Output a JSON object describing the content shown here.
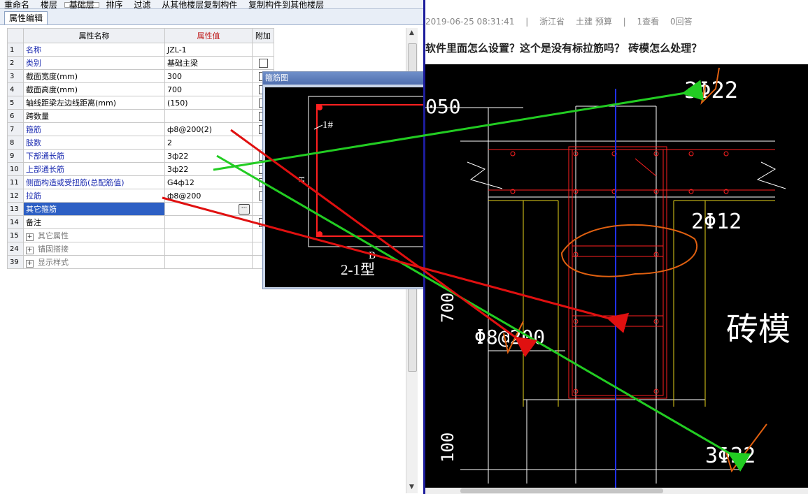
{
  "toolbar": {
    "items": [
      "重命名",
      "楼层",
      "基础层",
      "排序",
      "过滤",
      "从其他楼层复制构件",
      "复制构件到其他楼层"
    ]
  },
  "tab": {
    "label": "属性编辑"
  },
  "grid": {
    "headers": {
      "name": "属性名称",
      "value": "属性值",
      "extra": "附加"
    },
    "rows": [
      {
        "idx": "1",
        "name": "名称",
        "value": "JZL-1",
        "blue": true,
        "check": false
      },
      {
        "idx": "2",
        "name": "类别",
        "value": "基础主梁",
        "blue": true,
        "check": true
      },
      {
        "idx": "3",
        "name": "截面宽度(mm)",
        "value": "300",
        "blue": false,
        "check": true
      },
      {
        "idx": "4",
        "name": "截面高度(mm)",
        "value": "700",
        "blue": false,
        "check": true
      },
      {
        "idx": "5",
        "name": "轴线距梁左边线距离(mm)",
        "value": "(150)",
        "blue": false,
        "check": true
      },
      {
        "idx": "6",
        "name": "跨数量",
        "value": "",
        "blue": false,
        "check": true
      },
      {
        "idx": "7",
        "name": "箍筋",
        "value": "ф8@200(2)",
        "blue": true,
        "check": true
      },
      {
        "idx": "8",
        "name": "肢数",
        "value": "2",
        "blue": true,
        "check": false
      },
      {
        "idx": "9",
        "name": "下部通长筋",
        "value": "3ф22",
        "blue": true,
        "check": true
      },
      {
        "idx": "10",
        "name": "上部通长筋",
        "value": "3ф22",
        "blue": true,
        "check": true
      },
      {
        "idx": "11",
        "name": "侧面构造或受扭筋(总配筋值)",
        "value": "G4ф12",
        "blue": true,
        "check": true
      },
      {
        "idx": "12",
        "name": "拉筋",
        "value": "ф8@200",
        "blue": true,
        "check": true
      },
      {
        "idx": "13",
        "name": "其它箍筋",
        "value": "",
        "blue": false,
        "check": false,
        "selected": true
      },
      {
        "idx": "14",
        "name": "备注",
        "value": "",
        "blue": false,
        "check": true
      },
      {
        "idx": "15",
        "name": "其它属性",
        "value": "",
        "group": true
      },
      {
        "idx": "24",
        "name": "锚固搭接",
        "value": "",
        "group": true
      },
      {
        "idx": "39",
        "name": "显示样式",
        "value": "",
        "group": true
      }
    ]
  },
  "popup": {
    "title": "箍筋图",
    "label_1": "1#",
    "label_h": "H",
    "label_b": "B",
    "type_label": "2-1型"
  },
  "post": {
    "date": "2019-06-25 08:31:41",
    "sep": "|",
    "region": "浙江省",
    "tags": "土建 预算",
    "views": "1查看",
    "answers": "0回答",
    "question": "软件里面怎么设置？这个是没有标拉筋吗？ 砖模怎么处理？"
  },
  "cad": {
    "top_rebar": "3Φ22",
    "bottom_rebar": "3Φ22",
    "side_rebar": "2Φ12",
    "stirrup": "Φ8@200",
    "dim_50": "050",
    "dim_700": "700",
    "dim_100": "100",
    "brick_mold": "砖模"
  },
  "colors": {
    "accent_header": "#f7c16a",
    "selected_row": "#2d5fc4",
    "blue_text": "#1b2bb0",
    "arrow_red": "#e01010",
    "arrow_green": "#22cc22",
    "annot_orange": "#e06010"
  }
}
